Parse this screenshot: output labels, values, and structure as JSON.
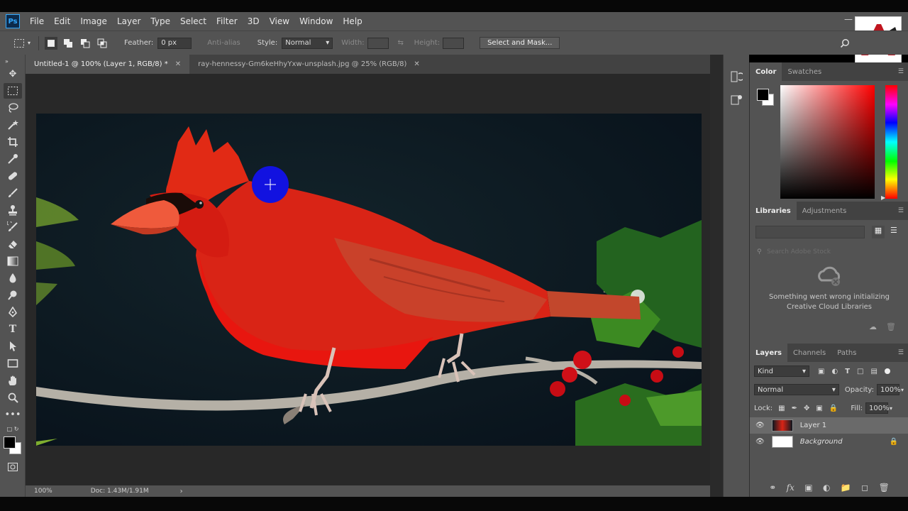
{
  "app": {
    "logo": "Ps"
  },
  "menu": [
    "File",
    "Edit",
    "Image",
    "Layer",
    "Type",
    "Select",
    "Filter",
    "3D",
    "View",
    "Window",
    "Help"
  ],
  "options": {
    "feather_label": "Feather:",
    "feather_value": "0 px",
    "anti_alias": "Anti-alias",
    "style_label": "Style:",
    "style_value": "Normal",
    "width_label": "Width:",
    "height_label": "Height:",
    "select_mask": "Select and Mask..."
  },
  "tabs": [
    {
      "label": "Untitled-1 @ 100% (Layer 1, RGB/8) *",
      "active": true
    },
    {
      "label": "ray-hennessy-Gm6keHhyYxw-unsplash.jpg @ 25% (RGB/8)",
      "active": false
    }
  ],
  "status": {
    "zoom": "100%",
    "doc": "Doc: 1.43M/1.91M"
  },
  "color_panel": {
    "tabs": [
      "Color",
      "Swatches"
    ],
    "fg": "#000000",
    "bg": "#ffffff"
  },
  "libraries_panel": {
    "tabs": [
      "Libraries",
      "Adjustments"
    ],
    "search_placeholder": "Search Adobe Stock",
    "message_line1": "Something went wrong initializing",
    "message_line2": "Creative Cloud Libraries"
  },
  "layers_panel": {
    "tabs": [
      "Layers",
      "Channels",
      "Paths"
    ],
    "kind": "Kind",
    "blend_mode": "Normal",
    "opacity_label": "Opacity:",
    "opacity_value": "100%",
    "lock_label": "Lock:",
    "fill_label": "Fill:",
    "fill_value": "100%",
    "layers": [
      {
        "name": "Layer 1",
        "selected": true
      },
      {
        "name": "Background",
        "selected": false
      }
    ]
  },
  "colors": {
    "accent": "#31a8ff",
    "brush": "#1212e0",
    "bird_red": "#e8160f"
  }
}
